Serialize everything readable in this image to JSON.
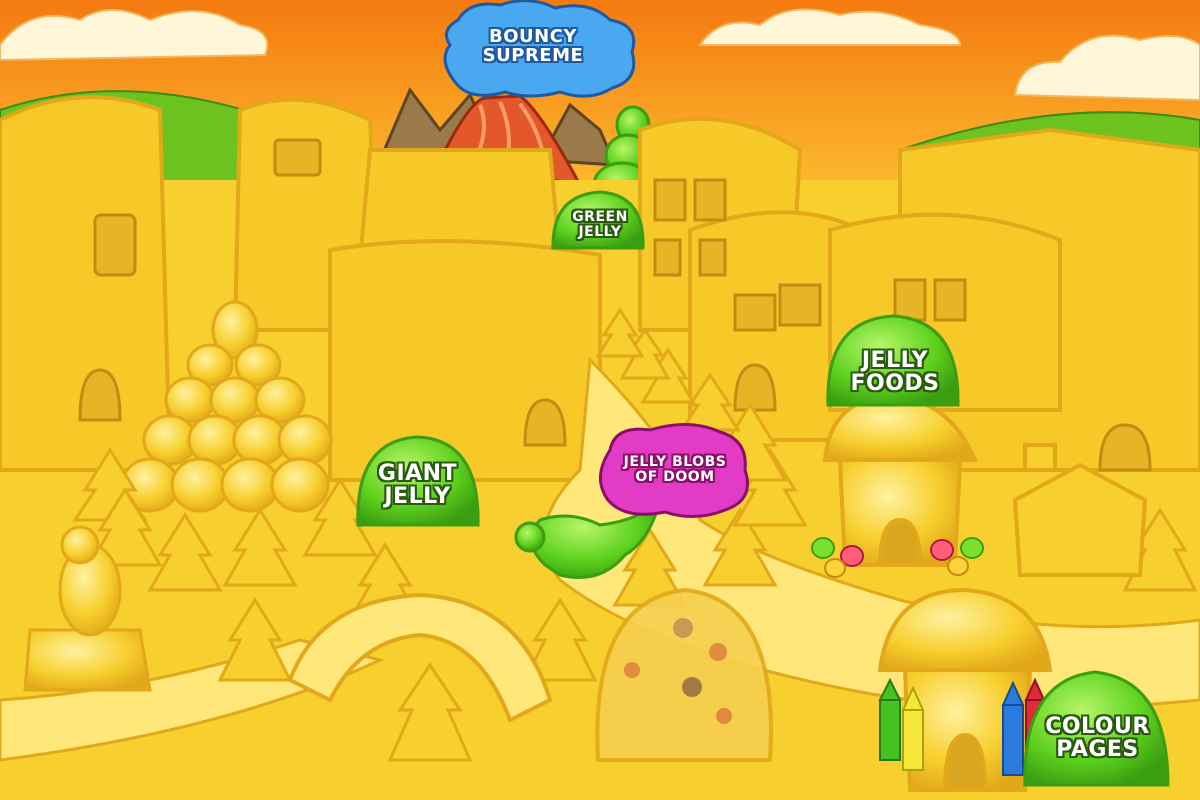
{
  "scene": {
    "colors": {
      "sky_top": "#f47a10",
      "sky_bottom": "#ffd23a",
      "hill_green": "#6cc21e",
      "jelly_yellow": "#f7cf2e",
      "jelly_outline": "#e2a81a",
      "path_light": "#ffe77a",
      "green_jelly": "#5fd21e",
      "blue_cloud": "#4aa8f0",
      "pink_blob": "#e23cc6",
      "volcano": "#e2582a",
      "rock": "#9a7a4a"
    }
  },
  "locations": {
    "bouncy_supreme": {
      "label": "BOUNCY\nSUPREME",
      "color": "#4aa8f0"
    },
    "green_jelly": {
      "label": "GREEN\nJELLY",
      "color": "#5fd21e"
    },
    "jelly_foods": {
      "label": "JELLY\nFOODS",
      "color": "#5fd21e"
    },
    "jelly_blobs_of_doom": {
      "label": "JELLY BLOBS\nOF DOOM",
      "color": "#e23cc6"
    },
    "giant_jelly": {
      "label": "GIANT\nJELLY",
      "color": "#5fd21e"
    },
    "colour_pages": {
      "label": "COLOUR\nPAGES",
      "color": "#5fd21e"
    }
  }
}
